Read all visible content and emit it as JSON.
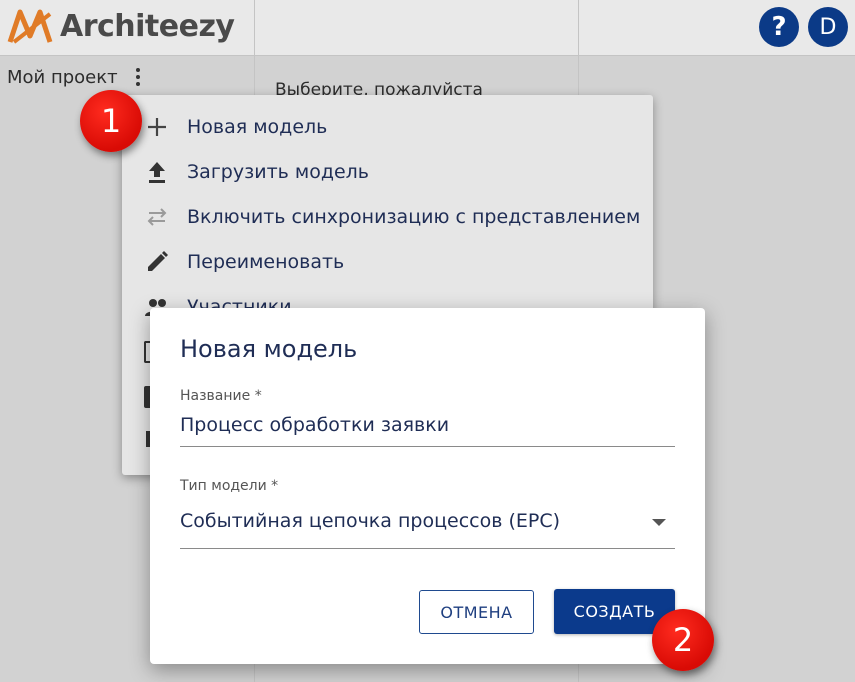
{
  "app": {
    "logo_text": "Architeezy",
    "help_label": "?",
    "avatar_initial": "D"
  },
  "project": {
    "title": "Мой проект",
    "hint": "Выберите, пожалуйста"
  },
  "menu": {
    "items": [
      {
        "label": "Новая модель",
        "icon": "plus-icon"
      },
      {
        "label": "Загрузить модель",
        "icon": "upload-icon"
      },
      {
        "label": "Включить синхронизацию с представлением",
        "icon": "sync-icon"
      },
      {
        "label": "Переименовать",
        "icon": "pencil-icon"
      },
      {
        "label": "Участники",
        "icon": "people-icon"
      }
    ]
  },
  "dialog": {
    "title": "Новая модель",
    "name_label": "Название *",
    "name_value": "Процесс обработки заявки",
    "type_label": "Тип модели *",
    "type_value": "Событийная цепочка процессов (EPC)",
    "cancel_label": "ОТМЕНА",
    "create_label": "СОЗДАТЬ"
  },
  "markers": [
    "1",
    "2"
  ],
  "colors": {
    "primary": "#0b3a8c",
    "text": "#1f2d55",
    "marker": "#e5140d",
    "logo_orange": "#e07b27"
  }
}
